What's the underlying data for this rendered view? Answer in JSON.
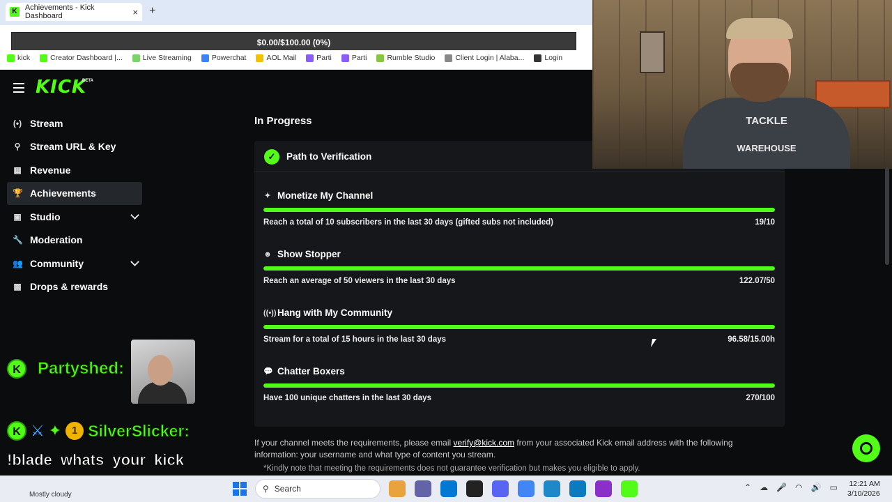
{
  "browser": {
    "tab_title": "Achievements - Kick Dashboard",
    "tab_close": "×",
    "new_tab": "+",
    "goal_bar": "$0.00/$100.00 (0%)",
    "bookmarks": [
      {
        "label": "kick",
        "color": "#53fc18"
      },
      {
        "label": "Creator Dashboard |...",
        "color": "#53fc18"
      },
      {
        "label": "Live Streaming",
        "color": "#7bd36b"
      },
      {
        "label": "Powerchat",
        "color": "#3b82f6"
      },
      {
        "label": "AOL Mail",
        "color": "#f2c200"
      },
      {
        "label": "Parti",
        "color": "#8b5cf6"
      },
      {
        "label": "Parti",
        "color": "#8b5cf6"
      },
      {
        "label": "Rumble Studio",
        "color": "#85c742"
      },
      {
        "label": "Client Login | Alaba...",
        "color": "#888888"
      },
      {
        "label": "Login",
        "color": "#333333"
      }
    ]
  },
  "header": {
    "logo": "KICK",
    "beta": "BETA"
  },
  "sidebar": {
    "items": [
      {
        "label": "Stream",
        "icon": "(•)"
      },
      {
        "label": "Stream URL & Key",
        "icon": "⚲"
      },
      {
        "label": "Revenue",
        "icon": "▦"
      },
      {
        "label": "Achievements",
        "icon": "🏆"
      },
      {
        "label": "Studio",
        "icon": "▣"
      },
      {
        "label": "Moderation",
        "icon": "🔧"
      },
      {
        "label": "Community",
        "icon": "👥"
      },
      {
        "label": "Drops & rewards",
        "icon": "▩"
      }
    ]
  },
  "main": {
    "section_title": "In Progress",
    "panel_title": "Path to Verification",
    "achievements": [
      {
        "title": "Monetize My Channel",
        "icon": "✦",
        "desc": "Reach a total of 10 subscribers in the last 30 days (gifted subs not included)",
        "value": "19/10",
        "progress": 1.0
      },
      {
        "title": "Show Stopper",
        "icon": "☻",
        "desc": "Reach an average of 50 viewers in the last 30 days",
        "value": "122.07/50",
        "progress": 1.0
      },
      {
        "title": "Hang with My Community",
        "icon": "((•))",
        "desc": "Stream for a total of 15 hours in the last 30 days",
        "value": "96.58/15.00h",
        "progress": 1.0
      },
      {
        "title": "Chatter Boxers",
        "icon": "💬",
        "desc": "Have 100 unique chatters in the last 30 days",
        "value": "270/100",
        "progress": 1.0
      }
    ],
    "footer_before": "If your channel meets the requirements, please email ",
    "footer_email": "verify@kick.com",
    "footer_after": " from your associated Kick email address with the following information: your username and what type of content you stream.",
    "disclaimer": "*Kindly note that meeting the requirements does not guarantee verification but makes you eligible to apply."
  },
  "webcam": {
    "shirt_line1": "TACKLE",
    "shirt_line2": "WAREHOUSE"
  },
  "chat": {
    "msg1_name": "Partyshed:",
    "msg2_name": "SilverSlicker:",
    "msg2_badge": "1",
    "msg2_text": "!blade whats your kick metrics lookin like"
  },
  "taskbar": {
    "weather": "Mostly cloudy",
    "search": "Search",
    "time": "12:21 AM",
    "date": "3/10/2026"
  },
  "colors": {
    "accent": "#53fc18",
    "background": "#0b0c0d",
    "panel": "#16171a"
  }
}
